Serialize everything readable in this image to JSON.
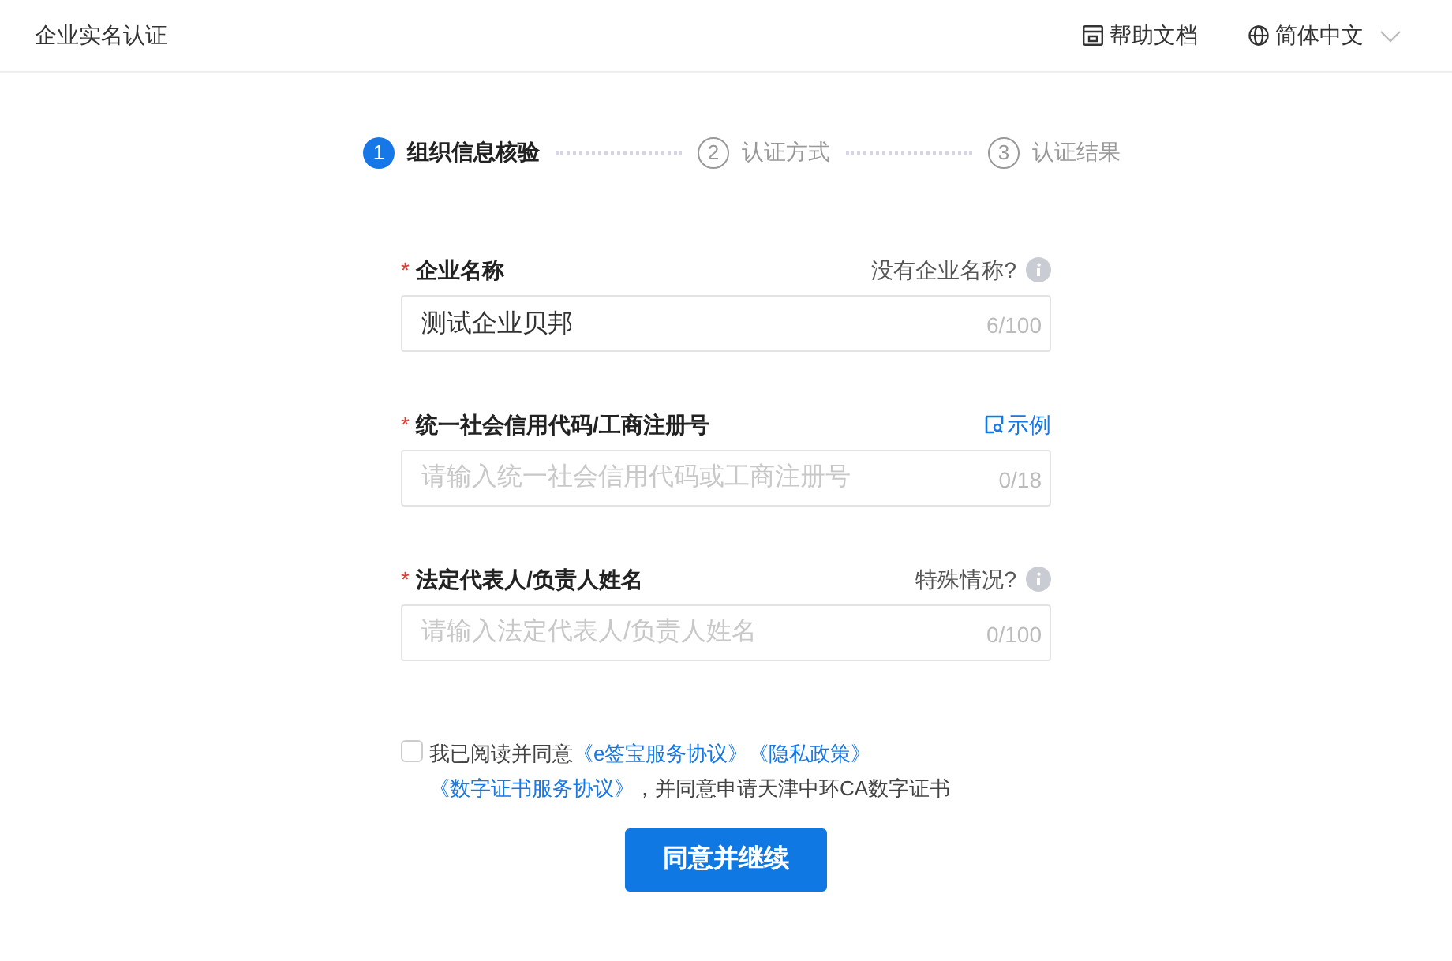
{
  "header": {
    "title": "企业实名认证",
    "help": "帮助文档",
    "language": "简体中文"
  },
  "steps": [
    {
      "number": "1",
      "label": "组织信息核验",
      "selected": true
    },
    {
      "number": "2",
      "label": "认证方式",
      "selected": false
    },
    {
      "number": "3",
      "label": "认证结果",
      "selected": false
    }
  ],
  "fields": [
    {
      "label": "企业名称",
      "required_mark": "*",
      "aside": {
        "kind": "help",
        "text": "没有企业名称?"
      },
      "value": "测试企业贝邦",
      "counter": "6/100"
    },
    {
      "label": "统一社会信用代码/工商注册号",
      "required_mark": "*",
      "aside": {
        "kind": "link",
        "text": "示例"
      },
      "placeholder": "请输入统一社会信用代码或工商注册号",
      "counter": "0/18"
    },
    {
      "label": "法定代表人/负责人姓名",
      "required_mark": "*",
      "aside": {
        "kind": "help",
        "text": "特殊情况?"
      },
      "placeholder": "请输入法定代表人/负责人姓名",
      "counter": "0/100"
    }
  ],
  "agreement": {
    "checked": false,
    "intro": "我已阅读并同意",
    "links": [
      "《e签宝服务协议》",
      "《隐私政策》",
      "《数字证书服务协议》"
    ],
    "outro": "，并同意申请天津中环CA数字证书"
  },
  "submit": "同意并继续"
}
